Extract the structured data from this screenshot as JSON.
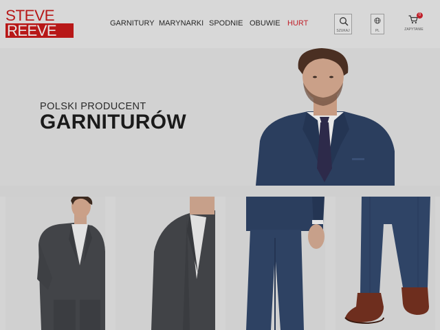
{
  "brand": {
    "line1": "STEVE",
    "line2": "REEVE"
  },
  "nav": {
    "items": [
      "GARNITURY",
      "MARYNARKI",
      "SPODNIE",
      "OBUWIE",
      "HURT"
    ]
  },
  "header": {
    "search_label": "SZUKAJ",
    "lang_label": "PL",
    "cart_label": "ZAPYTANIE",
    "cart_count": "0"
  },
  "hero": {
    "subtitle": "POLSKI PRODUCENT",
    "title": "GARNITURÓW"
  },
  "colors": {
    "brand_red": "#b81818",
    "accent_red": "#c0202a",
    "suit_navy": "#2b3e5e",
    "suit_grey": "#424448"
  },
  "tiles": [
    {
      "name": "grey-suit-model"
    },
    {
      "name": "grey-jacket-detail"
    },
    {
      "name": "navy-suit-model"
    },
    {
      "name": "navy-trousers-shoes"
    }
  ]
}
